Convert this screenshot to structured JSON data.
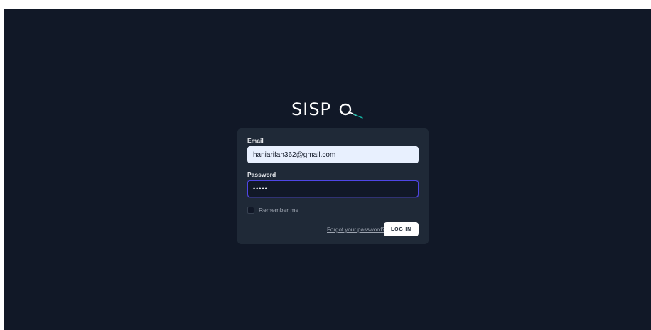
{
  "app": {
    "logo_text": "SISP",
    "logo_icon": "magnifier-icon"
  },
  "login_form": {
    "email_label": "Email",
    "email_value": "haniarifah362@gmail.com",
    "password_label": "Password",
    "password_masked": "•••••",
    "remember_label": "Remember me",
    "remember_checked": false,
    "forgot_label": "Forgot your password?",
    "login_label": "LOG IN"
  },
  "colors": {
    "background": "#111827",
    "card": "#1f2937",
    "focus_ring": "#4f46e5",
    "email_fill": "#e8f0fe"
  }
}
